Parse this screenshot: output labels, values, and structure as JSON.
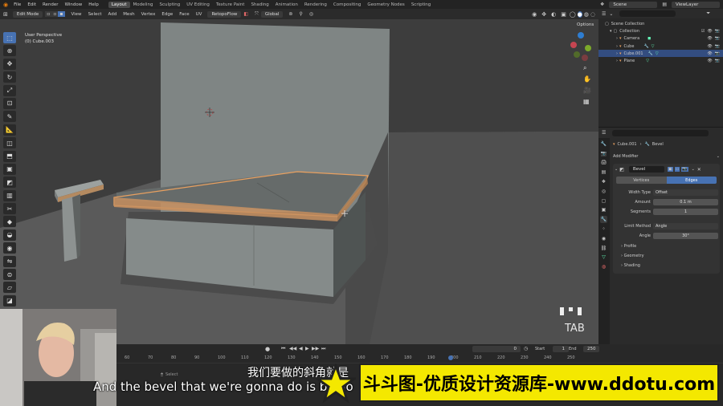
{
  "menu": [
    "File",
    "Edit",
    "Render",
    "Window",
    "Help"
  ],
  "workspaces": [
    "Layout",
    "Modeling",
    "Sculpting",
    "UV Editing",
    "Texture Paint",
    "Shading",
    "Animation",
    "Rendering",
    "Compositing",
    "Geometry Nodes",
    "Scripting"
  ],
  "active_workspace_index": 0,
  "scene": "Scene",
  "view_layer": "ViewLayer",
  "viewport_header": {
    "mode": "Edit Mode",
    "menus": [
      "View",
      "Select",
      "Add",
      "Mesh",
      "Vertex",
      "Edge",
      "Face",
      "UV"
    ],
    "addon": "RetopoFlow",
    "orientation": "Global",
    "options": "Options"
  },
  "viewport": {
    "view_name": "User Perspective",
    "object_name": "(0) Cube.003",
    "key_overlay": "TAB"
  },
  "outliner": {
    "root": "Scene Collection",
    "collection": "Collection",
    "items": [
      "Camera",
      "Cube",
      "Cube.001",
      "Plane"
    ],
    "selected_index": 2
  },
  "properties": {
    "object": "Cube.001",
    "modifier_tab": "Bevel",
    "add_modifier": "Add Modifier",
    "modifier_name": "Bevel",
    "affect": [
      "Vertices",
      "Edges"
    ],
    "affect_active": 1,
    "width_type_label": "Width Type",
    "width_type": "Offset",
    "amount_label": "Amount",
    "amount": "0.1 m",
    "segments_label": "Segments",
    "segments": "1",
    "limit_method_label": "Limit Method",
    "limit_method": "Angle",
    "angle_label": "Angle",
    "angle": "30°",
    "subpanels": [
      "Profile",
      "Geometry",
      "Shading"
    ]
  },
  "timeline": {
    "ticks": [
      "60",
      "70",
      "80",
      "90",
      "100",
      "110",
      "120",
      "130",
      "140",
      "150",
      "160",
      "170",
      "180",
      "190",
      "200",
      "210",
      "220",
      "230",
      "240",
      "250"
    ],
    "current_frame": "0",
    "start_label": "Start",
    "start": "1",
    "end_label": "End",
    "end": "250",
    "status": "Select"
  },
  "subtitles": {
    "chinese": "我们要做的斜角就是",
    "english": "And the bevel that we're gonna do is by go"
  },
  "watermark": "斗斗图-优质设计资源库-www.ddotu.com",
  "colors": {
    "selection_blue": "#4772b3",
    "bevel_orange": "#e8a060",
    "banner_yellow": "#f4e800"
  }
}
